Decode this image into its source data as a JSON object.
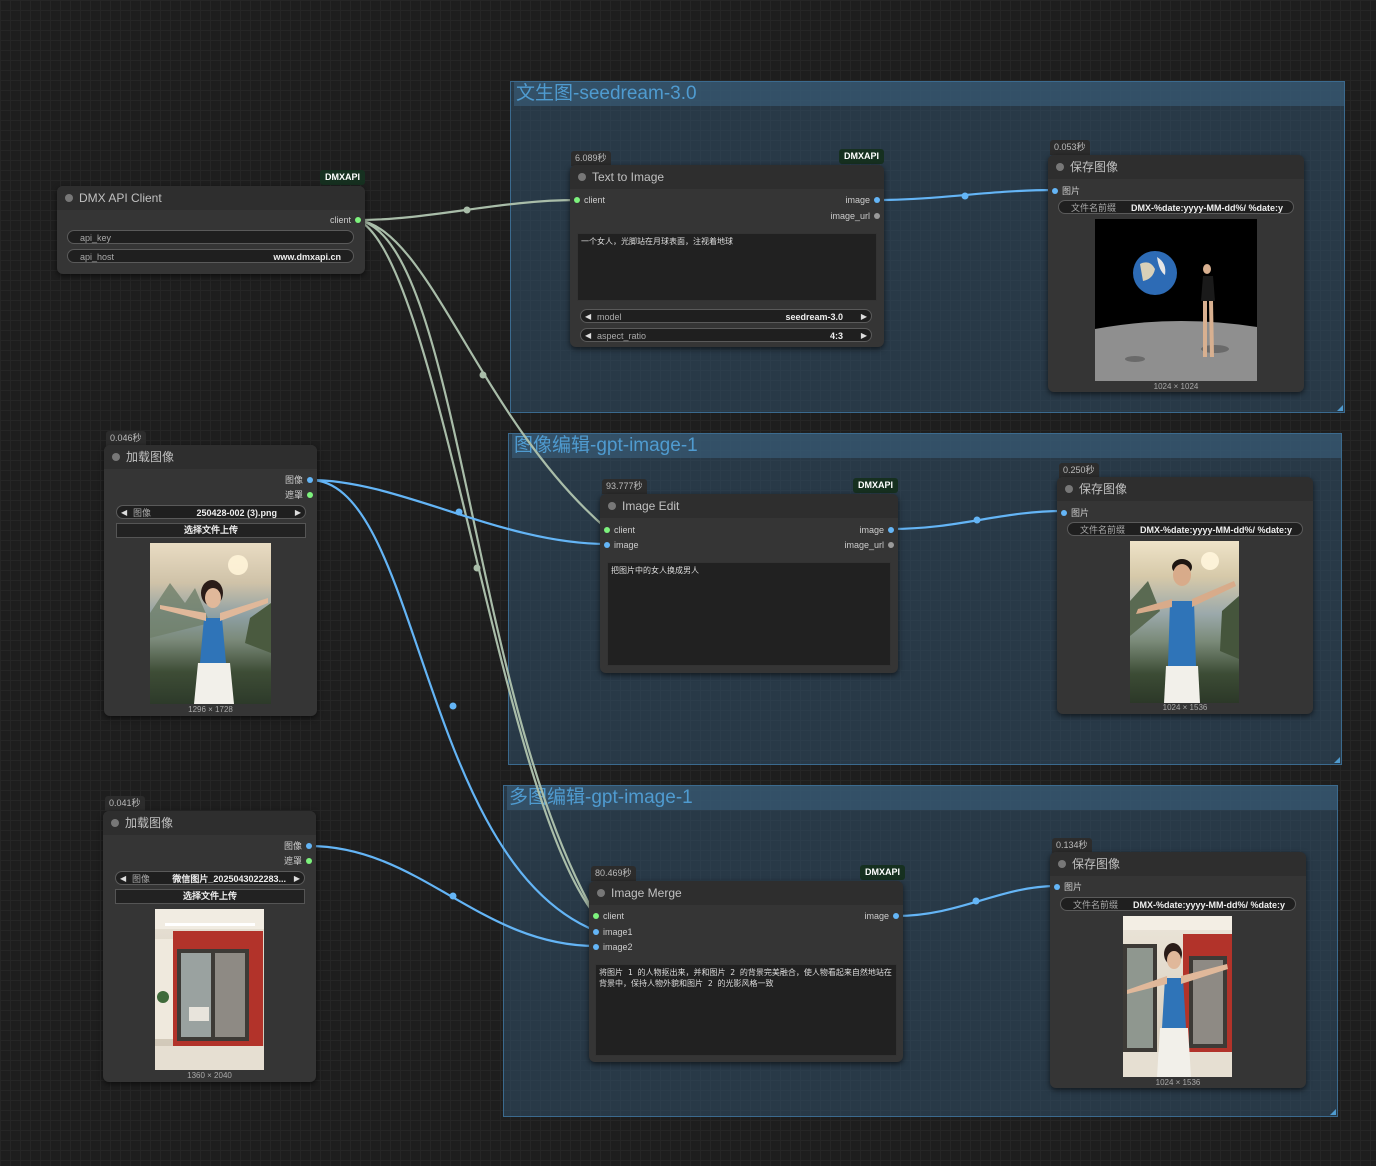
{
  "groups": {
    "g1": "文生图-seedream-3.0",
    "g2": "图像编辑-gpt-image-1",
    "g3": "多图编辑-gpt-image-1"
  },
  "brand": "DMXAPI",
  "client_node": {
    "title": "DMX API Client",
    "out_client": "client",
    "api_key_label": "api_key",
    "api_key_value": "",
    "api_host_label": "api_host",
    "api_host_value": "www.dmxapi.cn"
  },
  "load1": {
    "time": "0.046秒",
    "title": "加载图像",
    "out_image": "图像",
    "out_mask": "遮罩",
    "file_label": "图像",
    "file_value": "250428-002 (3).png",
    "upload": "选择文件上传",
    "dims": "1296 × 1728"
  },
  "load2": {
    "time": "0.041秒",
    "title": "加载图像",
    "out_image": "图像",
    "out_mask": "遮罩",
    "file_label": "图像",
    "file_value": "微信图片_2025043022283...",
    "upload": "选择文件上传",
    "dims": "1360 × 2040"
  },
  "t2i": {
    "time": "6.089秒",
    "title": "Text to Image",
    "in_client": "client",
    "out_image": "image",
    "out_url": "image_url",
    "prompt": "一个女人，光脚站在月球表面，注视着地球",
    "model_label": "model",
    "model_value": "seedream-3.0",
    "ratio_label": "aspect_ratio",
    "ratio_value": "4:3"
  },
  "save1": {
    "time": "0.053秒",
    "title": "保存图像",
    "in_image": "图片",
    "prefix_label": "文件名前缀",
    "prefix_value": "DMX-%date:yyyy-MM-dd%/ %date:y",
    "dims": "1024 × 1024"
  },
  "edit": {
    "time": "93.777秒",
    "title": "Image Edit",
    "in_client": "client",
    "in_image": "image",
    "out_image": "image",
    "out_url": "image_url",
    "prompt": "把图片中的女人换成男人"
  },
  "save2": {
    "time": "0.250秒",
    "title": "保存图像",
    "in_image": "图片",
    "prefix_label": "文件名前缀",
    "prefix_value": "DMX-%date:yyyy-MM-dd%/ %date:y",
    "dims": "1024 × 1536"
  },
  "merge": {
    "time": "80.469秒",
    "title": "Image Merge",
    "in_client": "client",
    "in_image1": "image1",
    "in_image2": "image2",
    "out_image": "image",
    "prompt": "将图片 1 的人物抠出来，并和图片 2 的背景完美融合，使人物看起来自然地站在背景中，保持人物外貌和图片 2 的光影风格一致"
  },
  "save3": {
    "time": "0.134秒",
    "title": "保存图像",
    "in_image": "图片",
    "prefix_label": "文件名前缀",
    "prefix_value": "DMX-%date:yyyy-MM-dd%/ %date:y",
    "dims": "1024 × 1536"
  }
}
